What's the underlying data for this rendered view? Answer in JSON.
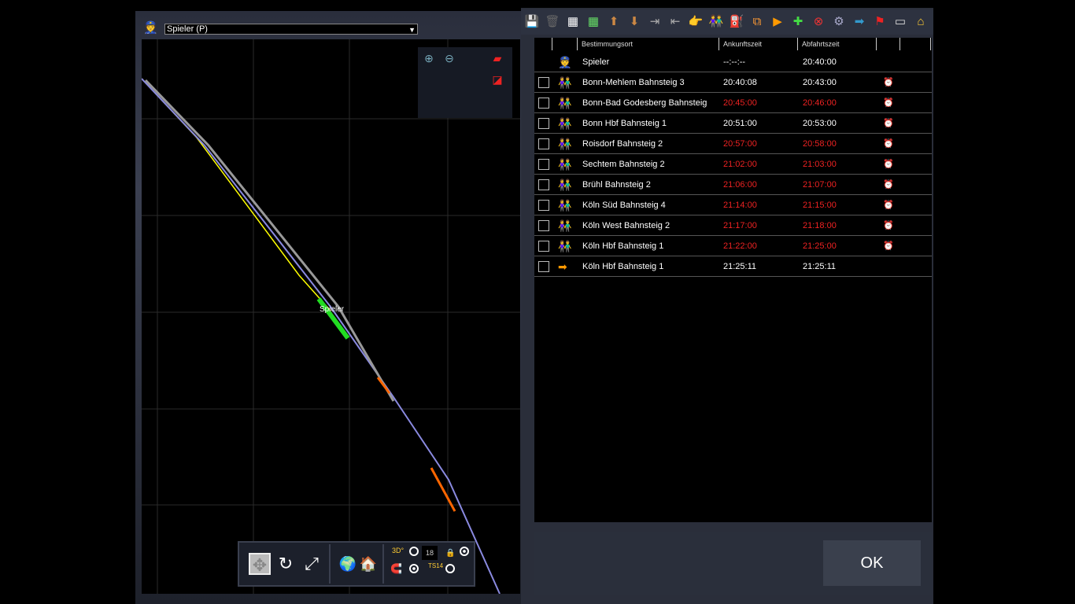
{
  "player_select": {
    "value": "Spieler (P)"
  },
  "map": {
    "train_label": "Spieler"
  },
  "bottombar": {
    "counter": "18",
    "ts_label": "TS14",
    "angle_label": "3D°"
  },
  "table": {
    "headers": [
      "Bestimmungsort",
      "Ankunftszeit",
      "Abfahrtszeit"
    ],
    "rows": [
      {
        "dest": "Spieler",
        "arr": "--:--:--",
        "dep": "20:40:00",
        "type": "player",
        "late": false,
        "checkbox": false,
        "alarm": false
      },
      {
        "dest": "Bonn-Mehlem Bahnsteig 3",
        "arr": "20:40:08",
        "dep": "20:43:00",
        "type": "passengers",
        "late": false,
        "checkbox": true,
        "alarm": true
      },
      {
        "dest": "Bonn-Bad Godesberg Bahnsteig",
        "arr": "20:45:00",
        "dep": "20:46:00",
        "type": "passengers",
        "late": true,
        "checkbox": true,
        "alarm": true
      },
      {
        "dest": "Bonn Hbf Bahnsteig 1",
        "arr": "20:51:00",
        "dep": "20:53:00",
        "type": "passengers",
        "late": false,
        "checkbox": true,
        "alarm": true
      },
      {
        "dest": "Roisdorf Bahnsteig 2",
        "arr": "20:57:00",
        "dep": "20:58:00",
        "type": "passengers",
        "late": true,
        "checkbox": true,
        "alarm": true
      },
      {
        "dest": "Sechtem Bahnsteig 2",
        "arr": "21:02:00",
        "dep": "21:03:00",
        "type": "passengers",
        "late": true,
        "checkbox": true,
        "alarm": true
      },
      {
        "dest": "Brühl Bahnsteig 2",
        "arr": "21:06:00",
        "dep": "21:07:00",
        "type": "passengers",
        "late": true,
        "checkbox": true,
        "alarm": true
      },
      {
        "dest": "Köln Süd Bahnsteig 4",
        "arr": "21:14:00",
        "dep": "21:15:00",
        "type": "passengers",
        "late": true,
        "checkbox": true,
        "alarm": true
      },
      {
        "dest": "Köln West Bahnsteig 2",
        "arr": "21:17:00",
        "dep": "21:18:00",
        "type": "passengers",
        "late": true,
        "checkbox": true,
        "alarm": true
      },
      {
        "dest": "Köln Hbf Bahnsteig 1",
        "arr": "21:22:00",
        "dep": "21:25:00",
        "type": "passengers",
        "late": true,
        "checkbox": true,
        "alarm": true
      },
      {
        "dest": "Köln Hbf Bahnsteig 1",
        "arr": "21:25:11",
        "dep": "21:25:11",
        "type": "exit",
        "late": false,
        "checkbox": true,
        "alarm": false
      }
    ]
  },
  "ok_label": "OK",
  "colors": {
    "late": "#e22222",
    "panel": "#2a2e3a"
  }
}
